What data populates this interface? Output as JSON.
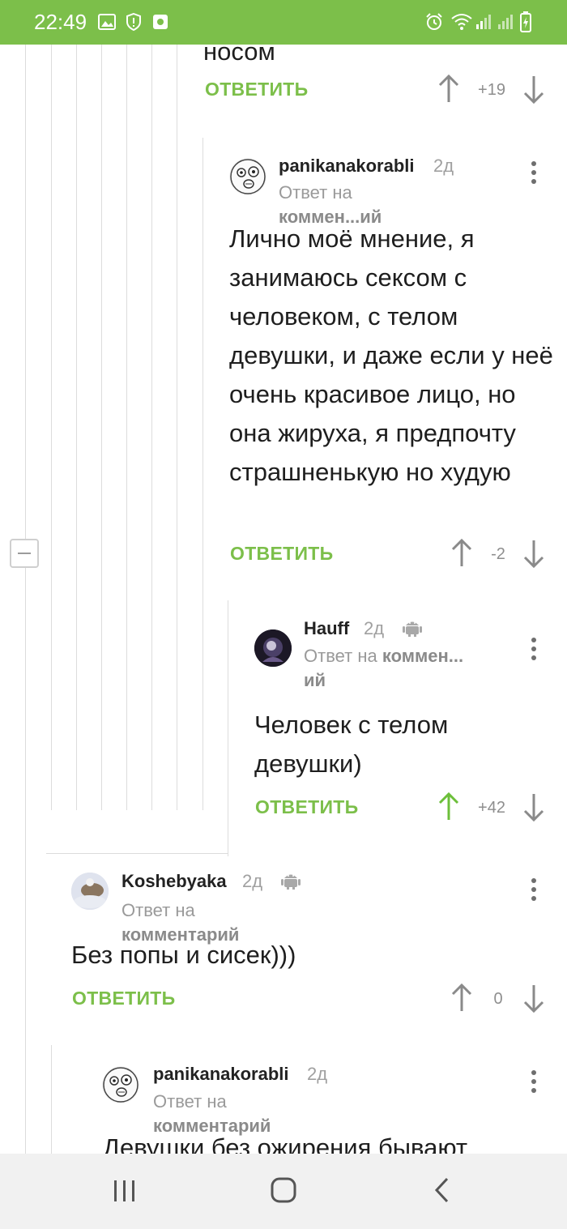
{
  "status_bar": {
    "time": "22:49",
    "left_icons": [
      "image-icon",
      "shield-icon",
      "app-icon"
    ],
    "right_icons": [
      "alarm-icon",
      "wifi-icon",
      "signal-icon",
      "battery-icon"
    ],
    "background": "#7cbf4a"
  },
  "top_comment": {
    "text_tail": "носом",
    "reply_label": "ОТВЕТИТЬ",
    "score": "+19"
  },
  "comments": [
    {
      "author": "panikanakorabli",
      "time": "2д",
      "reply_prefix": "Ответ на",
      "reply_target": "коммен...ий",
      "text": "Лично моё мнение, я занимаюсь сексом с человеком, с телом девушки, и даже если у неё очень красивое лицо, но она жируха, я предпочту страшненькую но худую",
      "reply_label": "ОТВЕТИТЬ",
      "score": "-2"
    },
    {
      "author": "Hauff",
      "time": "2д",
      "reply_prefix": "Ответ на",
      "reply_target": "коммен...",
      "reply_target_tail": "ий",
      "text": "Человек с телом девушки)",
      "reply_label": "ОТВЕТИТЬ",
      "score": "+42",
      "upvoted": true
    },
    {
      "author": "Koshebyaka",
      "time": "2д",
      "reply_prefix": "Ответ на",
      "reply_target": "комментарий",
      "text": "Без попы и сисек)))",
      "reply_label": "ОТВЕТИТЬ",
      "score": "0"
    },
    {
      "author": "panikanakorabli",
      "time": "2д",
      "reply_prefix": "Ответ на",
      "reply_target": "комментарий",
      "text": "Девушки без ожирения бывают"
    }
  ],
  "colors": {
    "accent": "#7cbf4a",
    "muted": "#9a9a9a",
    "thread_line": "#dcdcdc"
  },
  "nav_bar": {
    "buttons": [
      "recents-icon",
      "home-icon",
      "back-icon"
    ]
  }
}
